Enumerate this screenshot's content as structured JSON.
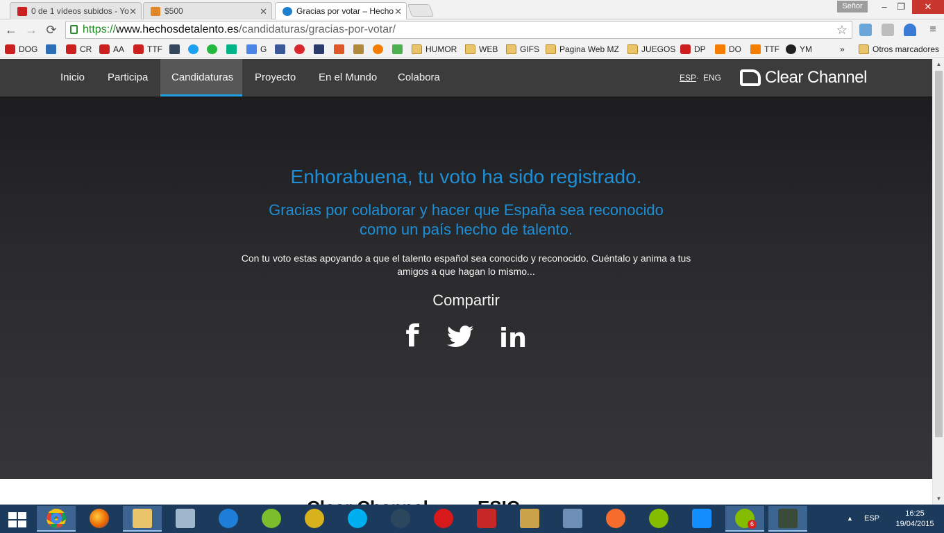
{
  "browser": {
    "tabs": [
      {
        "title": "0 de 1 vídeos subidos - Yo",
        "favicon_color": "#cc1f1f"
      },
      {
        "title": "$500",
        "favicon_color": "#e0872a"
      },
      {
        "title": "Gracias por votar – Hecho",
        "favicon_color": "#1e7fcc"
      }
    ],
    "profile_name": "Señor",
    "window_controls": {
      "minimize": "–",
      "restore": "❐",
      "close": "✕"
    },
    "url": {
      "scheme": "https://",
      "host": "www.hechosdetalento.es",
      "path": "/candidaturas/gracias-por-votar/"
    },
    "bookmarks": [
      {
        "label": "DOG",
        "icon": "youtube-icon"
      },
      {
        "label": "",
        "icon": "hootsuite-icon"
      },
      {
        "label": "CR",
        "icon": "youtube-icon"
      },
      {
        "label": "AA",
        "icon": "youtube-icon"
      },
      {
        "label": "TTF",
        "icon": "youtube-icon"
      },
      {
        "label": "",
        "icon": "tumblr-icon"
      },
      {
        "label": "",
        "icon": "twitter-icon"
      },
      {
        "label": "",
        "icon": "whatsapp-icon"
      },
      {
        "label": "",
        "icon": "vine-icon"
      },
      {
        "label": "G",
        "icon": "google-icon"
      },
      {
        "label": "",
        "icon": "facebook-icon"
      },
      {
        "label": "",
        "icon": "mega-icon"
      },
      {
        "label": "",
        "icon": "news-icon"
      },
      {
        "label": "",
        "icon": "grammarly-icon"
      },
      {
        "label": "",
        "icon": "shield-icon"
      },
      {
        "label": "",
        "icon": "blogger-icon"
      },
      {
        "label": "",
        "icon": "cube-icon"
      },
      {
        "label": "HUMOR",
        "icon": "folder-icon"
      },
      {
        "label": "WEB",
        "icon": "folder-icon"
      },
      {
        "label": "GIFS",
        "icon": "folder-icon"
      },
      {
        "label": "Pagina Web MZ",
        "icon": "folder-icon"
      },
      {
        "label": "JUEGOS",
        "icon": "folder-icon"
      },
      {
        "label": "DP",
        "icon": "youtube-icon"
      },
      {
        "label": "DO",
        "icon": "blogger-icon"
      },
      {
        "label": "TTF",
        "icon": "blogger-icon"
      },
      {
        "label": "YM",
        "icon": "headphones-icon"
      }
    ],
    "bookmarks_overflow": "»",
    "other_bookmarks": "Otros marcadores"
  },
  "site": {
    "nav": [
      "Inicio",
      "Participa",
      "Candidaturas",
      "Proyecto",
      "En el Mundo",
      "Colabora"
    ],
    "active_nav": "Candidaturas",
    "lang_esp": "ESP",
    "lang_sep": "·",
    "lang_eng": "ENG",
    "brand": "Clear Channel",
    "accent_color": "#1e8fd6"
  },
  "hero": {
    "headline": "Enhorabuena, tu voto ha sido registrado.",
    "subhead": "Gracias por colaborar y hacer que España sea reconocido como un país hecho de talento.",
    "body": "Con tu voto estas apoyando a que el talento español sea conocido y reconocido. Cuéntalo y anima a tus amigos a que hagan lo mismo...",
    "share_title": "Compartir",
    "share_buttons": [
      {
        "label": "f",
        "icon": "facebook-icon"
      },
      {
        "label": "🐦",
        "icon": "twitter-icon"
      },
      {
        "label": "in",
        "icon": "linkedin-icon"
      }
    ]
  },
  "footer": {
    "logos": [
      "Clear Channel",
      "ESIC"
    ]
  },
  "taskbar": {
    "apps": [
      {
        "name": "chrome",
        "active": true
      },
      {
        "name": "firefox"
      },
      {
        "name": "file-explorer",
        "active": true
      },
      {
        "name": "my-computer"
      },
      {
        "name": "thunder"
      },
      {
        "name": "utorrent"
      },
      {
        "name": "gps-app"
      },
      {
        "name": "skype"
      },
      {
        "name": "steam"
      },
      {
        "name": "recorder"
      },
      {
        "name": "feather-app"
      },
      {
        "name": "league-of-legends"
      },
      {
        "name": "paint-app"
      },
      {
        "name": "origin"
      },
      {
        "name": "spotify"
      },
      {
        "name": "battle-net"
      },
      {
        "name": "spotify-2",
        "active": true,
        "badge": "6"
      },
      {
        "name": "console-app",
        "active": true
      }
    ],
    "tray_arrow": "▲",
    "language": "ESP",
    "time": "16:25",
    "date": "19/04/2015"
  }
}
